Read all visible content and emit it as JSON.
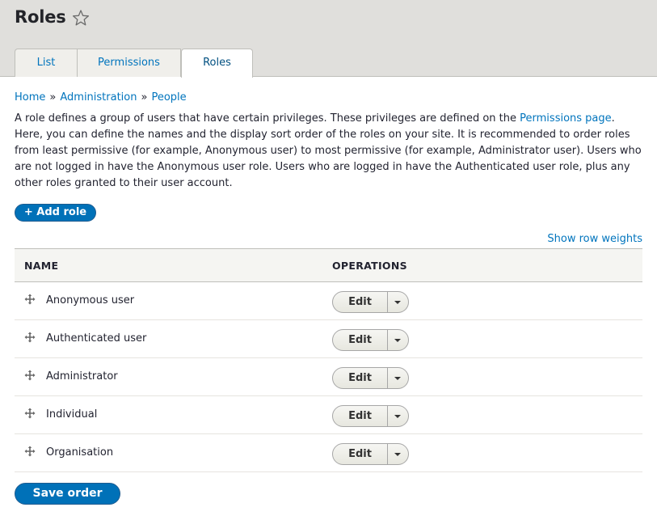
{
  "page": {
    "title": "Roles"
  },
  "tabs": [
    {
      "label": "List"
    },
    {
      "label": "Permissions"
    },
    {
      "label": "Roles"
    }
  ],
  "breadcrumb": [
    {
      "label": "Home"
    },
    {
      "label": "Administration"
    },
    {
      "label": "People"
    }
  ],
  "breadcrumb_separator": "»",
  "description": {
    "before_link": "A role defines a group of users that have certain privileges. These privileges are defined on the ",
    "link": "Permissions page",
    "after_link": ". Here, you can define the names and the display sort order of the roles on your site. It is recommended to order roles from least permissive (for example, Anonymous user) to most permissive (for example, Administrator user). Users who are not logged in have the Anonymous user role. Users who are logged in have the Authenticated user role, plus any other roles granted to their user account."
  },
  "actions": {
    "add_role": "+ Add role",
    "show_row_weights": "Show row weights",
    "save_order": "Save order"
  },
  "table": {
    "columns": [
      "NAME",
      "OPERATIONS"
    ],
    "rows": [
      {
        "name": "Anonymous user",
        "operation": "Edit"
      },
      {
        "name": "Authenticated user",
        "operation": "Edit"
      },
      {
        "name": "Administrator",
        "operation": "Edit"
      },
      {
        "name": "Individual",
        "operation": "Edit"
      },
      {
        "name": "Organisation",
        "operation": "Edit"
      }
    ]
  },
  "icons": {
    "favorite": "star-outline-icon",
    "drag": "drag-handle-icon",
    "dropdown": "chevron-down-icon"
  },
  "colors": {
    "link": "#0074bd",
    "primary_button": "#0071b8",
    "header_bg": "#e0dfdc"
  }
}
